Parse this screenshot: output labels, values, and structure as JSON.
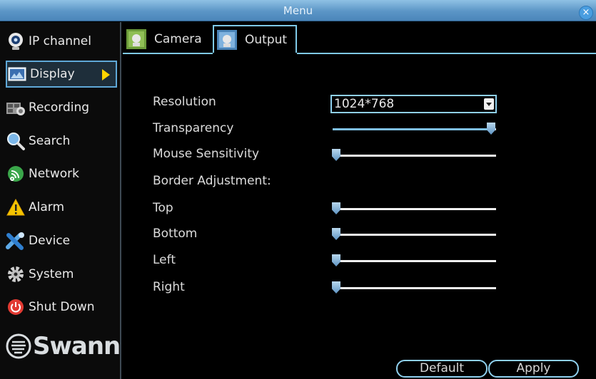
{
  "window": {
    "title": "Menu",
    "close_label": "×"
  },
  "sidebar": {
    "items": [
      {
        "label": "IP channel",
        "icon": "ip-camera-icon"
      },
      {
        "label": "Display",
        "icon": "display-icon",
        "active": true
      },
      {
        "label": "Recording",
        "icon": "recording-icon"
      },
      {
        "label": "Search",
        "icon": "search-icon"
      },
      {
        "label": "Network",
        "icon": "network-icon"
      },
      {
        "label": "Alarm",
        "icon": "alarm-icon"
      },
      {
        "label": "Device",
        "icon": "device-icon"
      },
      {
        "label": "System",
        "icon": "gear-icon"
      },
      {
        "label": "Shut Down",
        "icon": "power-icon"
      }
    ],
    "logo_text": "Swann"
  },
  "tabs": [
    {
      "label": "Camera",
      "icon": "camera-tab-icon"
    },
    {
      "label": "Output",
      "icon": "output-tab-icon",
      "active": true
    }
  ],
  "settings": {
    "resolution": {
      "label": "Resolution",
      "value": "1024*768"
    },
    "transparency": {
      "label": "Transparency",
      "level": 1.0
    },
    "mouse_sensitivity": {
      "label": "Mouse Sensitivity",
      "level": 0.0
    },
    "border_adjustment_label": "Border Adjustment:",
    "top": {
      "label": "Top",
      "level": 0.0
    },
    "bottom": {
      "label": "Bottom",
      "level": 0.0
    },
    "left": {
      "label": "Left",
      "level": 0.0
    },
    "right": {
      "label": "Right",
      "level": 0.0
    }
  },
  "buttons": {
    "default_label": "Default",
    "apply_label": "Apply"
  },
  "colors": {
    "accent": "#7fc9e8",
    "titlebar": "#5b95c6",
    "selected_arrow": "#ffd400"
  }
}
